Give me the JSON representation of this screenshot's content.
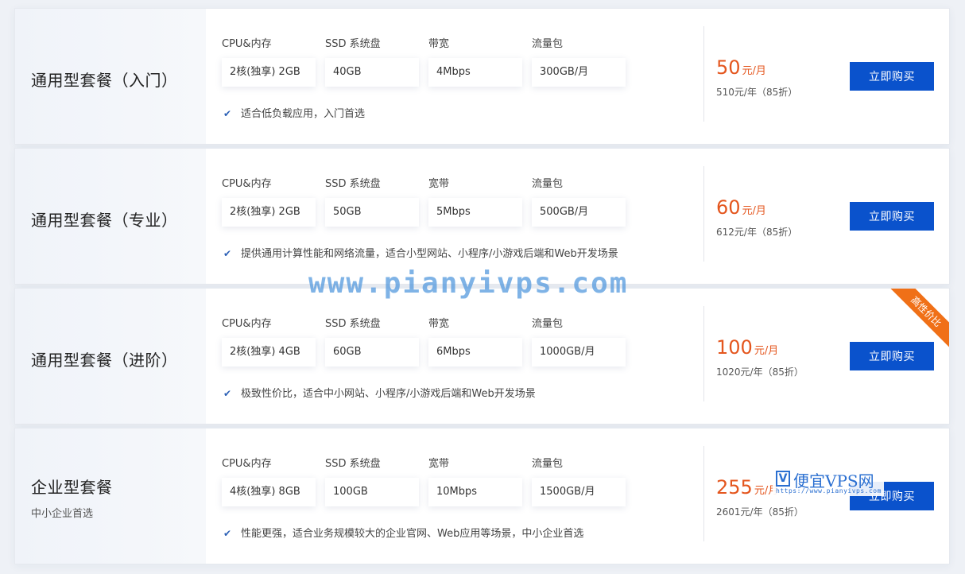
{
  "spec_labels": {
    "cpu": "CPU&内存",
    "ssd": "SSD 系统盘",
    "bandwidth": "带宽",
    "bandwidth_alt": "宽带",
    "traffic": "流量包"
  },
  "buy_label": "立即购买",
  "ribbon_label": "高性价比",
  "plans": [
    {
      "name": "通用型套餐（入门）",
      "cpu": "2核(独享) 2GB",
      "ssd": "40GB",
      "bandwidth": "4Mbps",
      "traffic": "300GB/月",
      "description": "适合低负载应用，入门首选",
      "price": "50",
      "price_unit": "元/月",
      "yearly": "510元/年（85折）"
    },
    {
      "name": "通用型套餐（专业）",
      "cpu": "2核(独享) 2GB",
      "ssd": "50GB",
      "bandwidth": "5Mbps",
      "traffic": "500GB/月",
      "description": "提供通用计算性能和网络流量，适合小型网站、小程序/小游戏后端和Web开发场景",
      "price": "60",
      "price_unit": "元/月",
      "yearly": "612元/年（85折）"
    },
    {
      "name": "通用型套餐（进阶）",
      "cpu": "2核(独享) 4GB",
      "ssd": "60GB",
      "bandwidth": "6Mbps",
      "traffic": "1000GB/月",
      "description": "极致性价比，适合中小网站、小程序/小游戏后端和Web开发场景",
      "price": "100",
      "price_unit": "元/月",
      "yearly": "1020元/年（85折）"
    },
    {
      "name": "企业型套餐",
      "subtitle": "中小企业首选",
      "cpu": "4核(独享) 8GB",
      "ssd": "100GB",
      "bandwidth": "10Mbps",
      "traffic": "1500GB/月",
      "description": "性能更强，适合业务规模较大的企业官网、Web应用等场景，中小企业首选",
      "price": "255",
      "price_unit": "元/月",
      "yearly": "2601元/年（85折）"
    }
  ],
  "watermark": {
    "site": "www.pianyivps.com",
    "logo_letter": "V",
    "logo_text": "便宜VPS网",
    "logo_url": "https://www.pianyivps.com"
  },
  "colors": {
    "accent": "#0a52cc",
    "price": "#e4561e",
    "ribbon": "#f07017"
  }
}
